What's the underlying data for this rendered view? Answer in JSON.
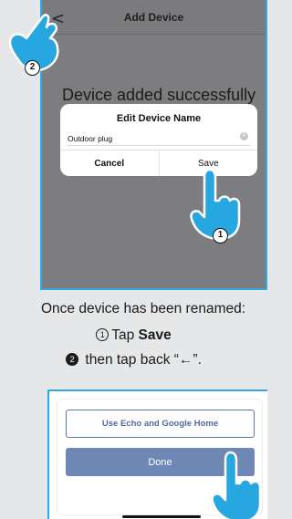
{
  "app": {
    "nav_title": "Add Device",
    "back_glyph": "<",
    "success_message": "Device added successfully"
  },
  "dialog": {
    "title": "Edit Device Name",
    "input_value": "Outdoor plug",
    "cancel_label": "Cancel",
    "save_label": "Save"
  },
  "badges": {
    "step1": "1",
    "step2": "2"
  },
  "instructions": {
    "line1": "Once device has been renamed:",
    "step1_num": "1",
    "step1_prefix": "Tap ",
    "step1_action": "Save",
    "step2_num": "2",
    "step2_text": "then tap back “←”."
  },
  "bottom_screen": {
    "echo_button_label": "Use Echo and Google Home",
    "done_button_label": "Done"
  },
  "colors": {
    "accent_blue": "#30a9da",
    "hand_blue": "#27a7df",
    "button_blue": "#6f87b5",
    "dim_overlay": "#7d7d80"
  },
  "icons": {
    "hand_cursor": "pointing-hand-icon",
    "clear_field": "clear-input-icon",
    "back": "back-chevron-icon"
  }
}
